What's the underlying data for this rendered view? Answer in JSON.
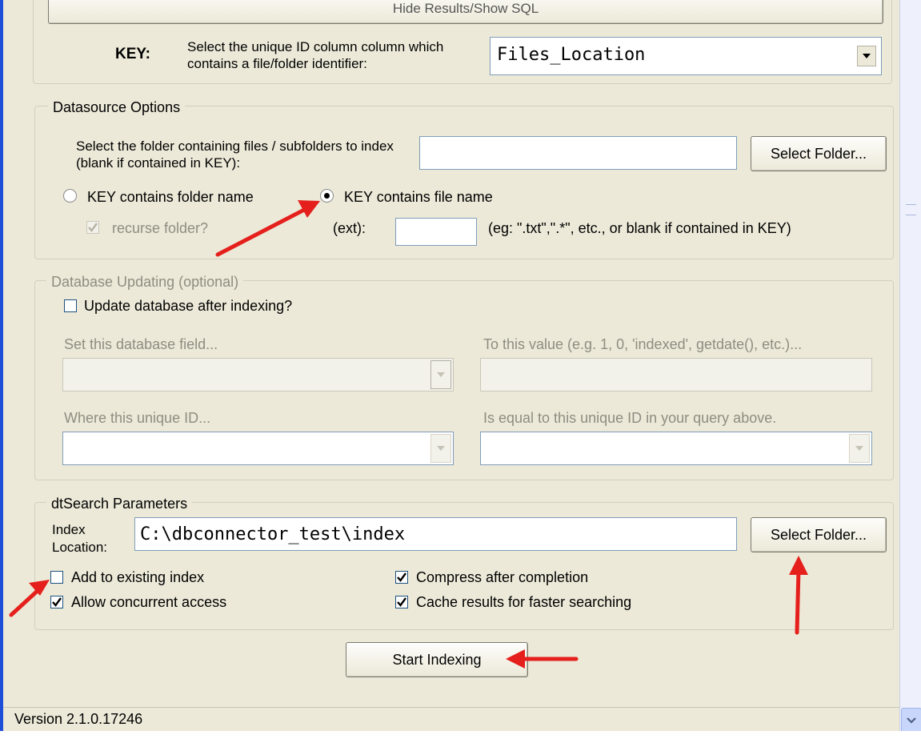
{
  "top_button_label": "Hide Results/Show SQL",
  "key": {
    "label": "KEY:",
    "instruction": "Select the unique ID column column which contains a file/folder identifier:",
    "selected_value": "Files_Location"
  },
  "datasource": {
    "legend": "Datasource Options",
    "folder_prompt": "Select the folder containing files / subfolders to index (blank if contained in KEY):",
    "folder_value": "",
    "select_folder_label": "Select Folder...",
    "radio_folder_label": "KEY contains folder name",
    "radio_file_label": "KEY contains file name",
    "selected_radio": "file",
    "recurse_label": "recurse folder?",
    "recurse_checked": true,
    "ext_label": "(ext):",
    "ext_value": "",
    "ext_hint": "(eg: \".txt\",\".*\", etc., or blank if contained in KEY)"
  },
  "db_update": {
    "legend": "Database Updating (optional)",
    "update_label": "Update database after indexing?",
    "update_checked": false,
    "set_field_label": "Set this database field...",
    "to_value_label": "To this value (e.g. 1, 0, 'indexed', getdate(), etc.)...",
    "where_label": "Where this unique ID...",
    "equal_label": "Is equal to this unique ID in your query above."
  },
  "dtsearch": {
    "legend": "dtSearch Parameters",
    "index_location_label": "Index Location:",
    "index_location_value": "C:\\dbconnector_test\\index",
    "select_folder_label": "Select Folder...",
    "options": [
      {
        "label": "Add to existing index",
        "checked": false
      },
      {
        "label": "Allow concurrent access",
        "checked": true
      },
      {
        "label": "Compress after completion",
        "checked": true
      },
      {
        "label": "Cache results for faster searching",
        "checked": true
      }
    ]
  },
  "start_button_label": "Start Indexing",
  "status": {
    "version": "Version 2.1.0.17246"
  },
  "colors": {
    "annotation_arrow": "#e5201c",
    "window_bg": "#ece9d8",
    "titlebar_blue": "#1f4fd8"
  }
}
